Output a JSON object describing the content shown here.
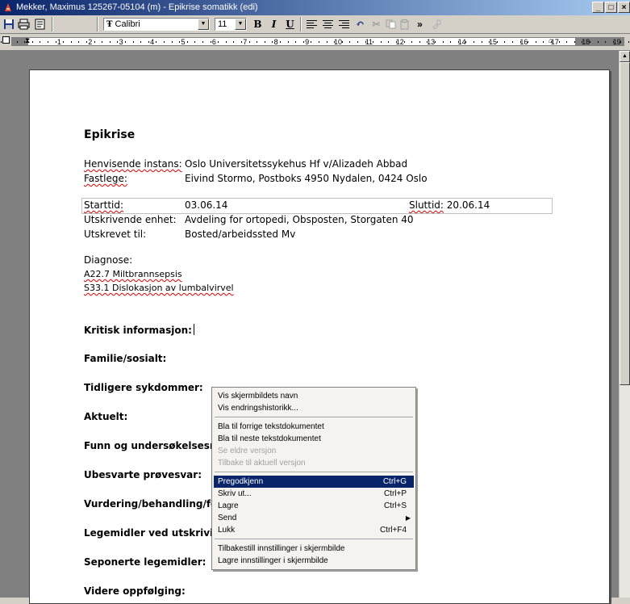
{
  "window": {
    "title": "Mekker, Maximus  125267-05104 (m) - Epikrise somatikk (edi)",
    "buttons": [
      "_",
      "□",
      "×"
    ]
  },
  "toolbar": {
    "font_name": "Calibri",
    "font_size": "11",
    "bold": "B",
    "italic": "I",
    "underline": "U",
    "more": "»"
  },
  "ruler": {
    "numbers": [
      "1",
      "1",
      "2",
      "3",
      "4",
      "5",
      "6",
      "7",
      "8",
      "9",
      "10",
      "11",
      "12",
      "13",
      "14",
      "15",
      "16",
      "17",
      "18",
      "19"
    ]
  },
  "document": {
    "heading": "Epikrise",
    "henvisende_label": "Henvisende instans:",
    "henvisende_value": "Oslo Universitetssykehus Hf v/Alizadeh Abbad",
    "fastlege_label": "Fastlege:",
    "fastlege_value": "Eivind Stormo, Postboks 4950 Nydalen, 0424 Oslo",
    "starttid_label": "Starttid:",
    "starttid_value": "03.06.14",
    "sluttid_label": "Sluttid:",
    "sluttid_value": "20.06.14",
    "utskrivende_label": "Utskrivende enhet:",
    "utskrivende_value": "Avdeling for ortopedi, Obsposten, Storgaten 40",
    "utskrevet_label": "Utskrevet til:",
    "utskrevet_value": "Bosted/arbeidssted Mv",
    "diagnose_label": "Diagnose:",
    "diagnose_1": "A22.7 Miltbrannsepsis",
    "diagnose_2": "S33.1 Dislokasjon av lumbalvirvel",
    "sections": [
      "Kritisk informasjon:",
      "Familie/sosialt:",
      "Tidligere sykdommer:",
      "Aktuelt:",
      "Funn og undersøkelsesresultater:",
      "Ubesvarte prøvesvar:",
      "Vurdering/behandling/forløp:",
      "Legemidler ved utskriving:",
      "Seponerte legemidler:",
      "Videre oppfølging:"
    ]
  },
  "context_menu": {
    "items": [
      {
        "label": "Vis skjermbildets navn",
        "shortcut": "",
        "disabled": false
      },
      {
        "label": "Vis endringshistorikk...",
        "shortcut": "",
        "disabled": false
      },
      {
        "label": "Bla til forrige tekstdokumentet",
        "shortcut": "",
        "disabled": false
      },
      {
        "label": "Bla til neste tekstdokumentet",
        "shortcut": "",
        "disabled": false
      },
      {
        "label": "Se eldre versjon",
        "shortcut": "",
        "disabled": true
      },
      {
        "label": "Tilbake til aktuell versjon",
        "shortcut": "",
        "disabled": true
      },
      {
        "label": "Pregodkjenn",
        "shortcut": "Ctrl+G",
        "disabled": false
      },
      {
        "label": "Skriv ut...",
        "shortcut": "Ctrl+P",
        "disabled": false
      },
      {
        "label": "Lagre",
        "shortcut": "Ctrl+S",
        "disabled": false
      },
      {
        "label": "Send",
        "shortcut": "",
        "disabled": false
      },
      {
        "label": "Lukk",
        "shortcut": "Ctrl+F4",
        "disabled": false
      },
      {
        "label": "Tilbakestill innstillinger i skjermbilde",
        "shortcut": "",
        "disabled": false
      },
      {
        "label": "Lagre innstillinger i skjermbilde",
        "shortcut": "",
        "disabled": false
      }
    ],
    "selected_label": "Pregodkjenn"
  },
  "colors": {
    "title_gradient_start": "#0a246a",
    "title_gradient_end": "#a6caf0",
    "menu_highlight": "#0a246a"
  }
}
